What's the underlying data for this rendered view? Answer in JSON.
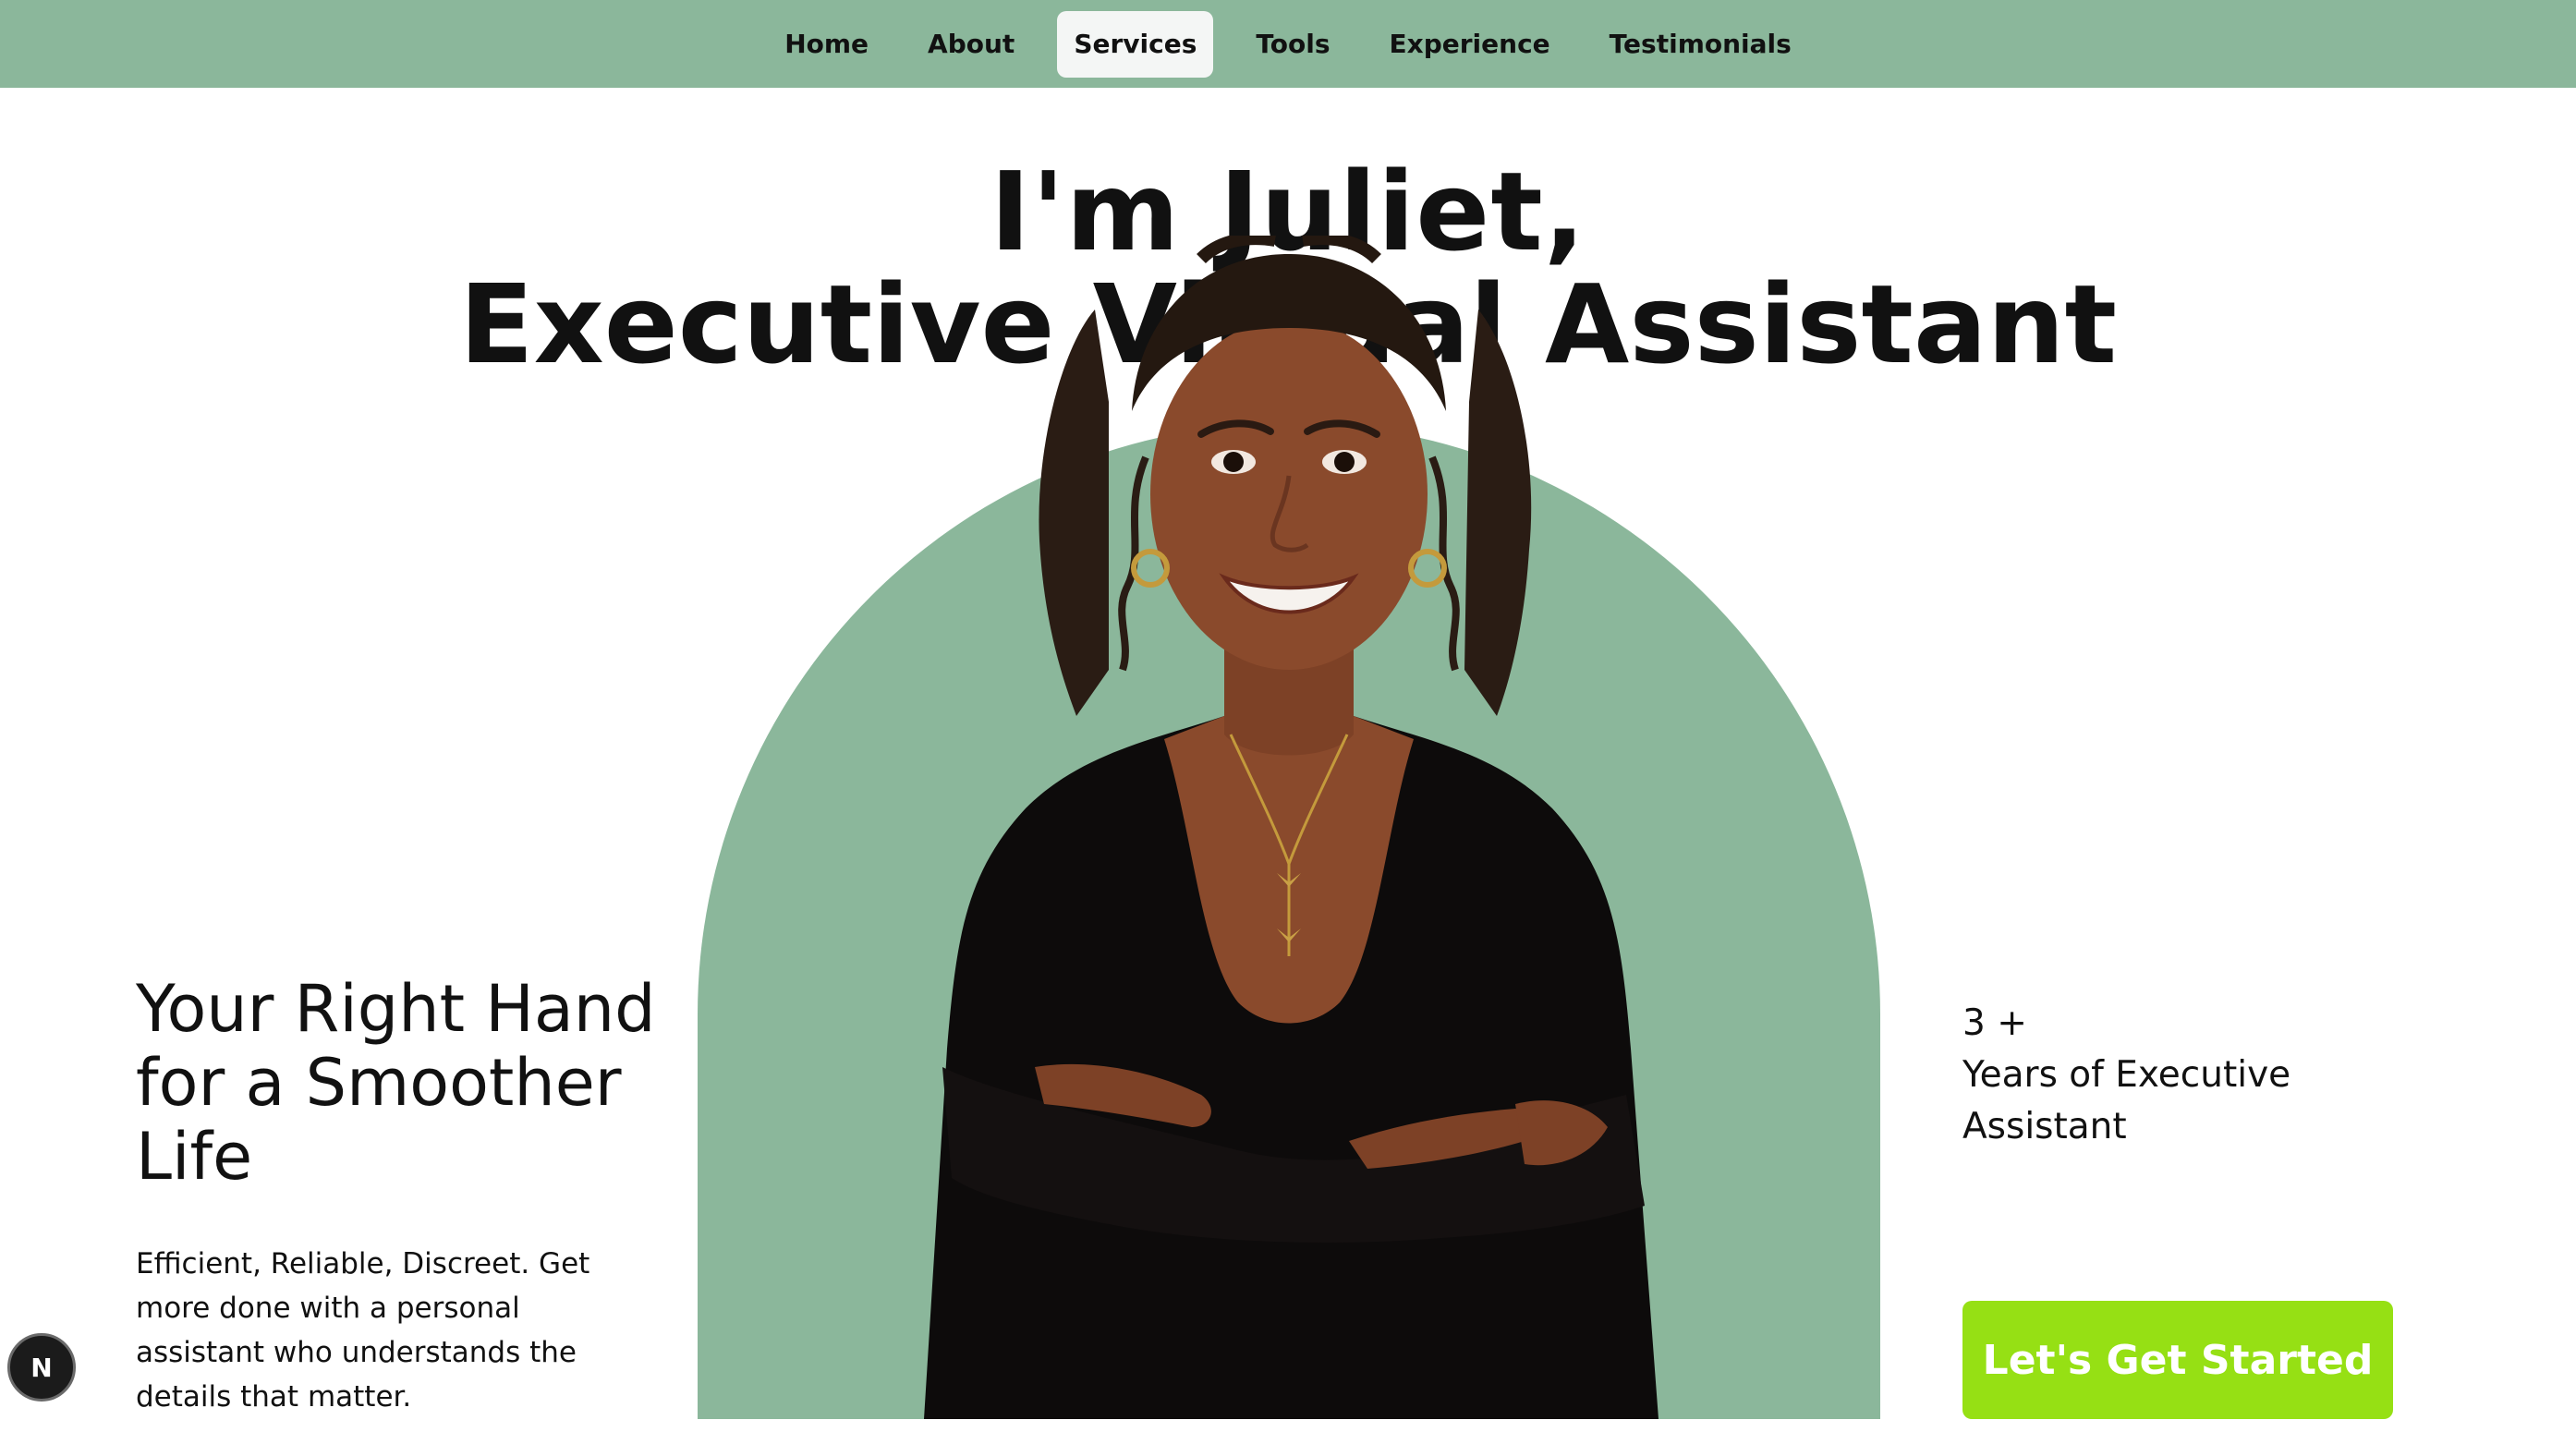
{
  "nav": {
    "items": [
      {
        "label": "Home",
        "active": false
      },
      {
        "label": "About",
        "active": false
      },
      {
        "label": "Services",
        "active": true
      },
      {
        "label": "Tools",
        "active": false
      },
      {
        "label": "Experience",
        "active": false
      },
      {
        "label": "Testimonials",
        "active": false
      }
    ]
  },
  "hero": {
    "headline_line1": "I'm Juliet,",
    "headline_line2": "Executive Virtual Assistant",
    "tagline": "Your Right Hand for a Smoother Life",
    "intro": "Efficient, Reliable, Discreet. Get more done with a personal assistant who understands the details that matter.",
    "portrait_alt": "Portrait of Juliet"
  },
  "stat": {
    "value": "3 +",
    "label": "Years of Executive Assistant"
  },
  "cta": {
    "label": "Let's Get Started"
  },
  "badge": {
    "letter": "N"
  },
  "colors": {
    "nav_bg": "#8bb79b",
    "arch_bg": "#8bb79b",
    "cta_bg": "#96e014",
    "cta_text": "#ffffff",
    "text": "#111111"
  }
}
